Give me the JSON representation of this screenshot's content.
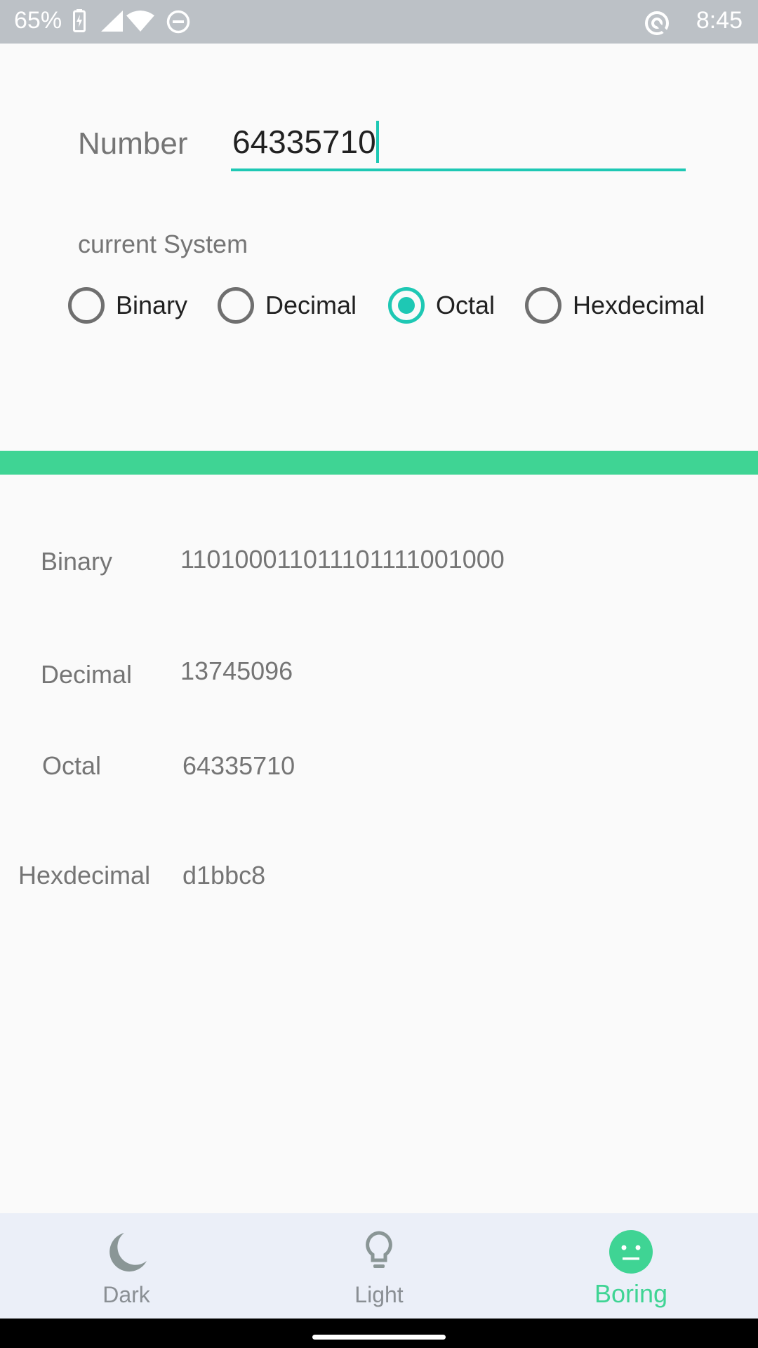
{
  "status_bar": {
    "battery": "65%",
    "time": "8:45"
  },
  "input": {
    "number_label": "Number",
    "number_value": "64335710",
    "system_label": "current System",
    "options": [
      "Binary",
      "Decimal",
      "Octal",
      "Hexdecimal"
    ],
    "selected": "Octal"
  },
  "results": [
    {
      "label": "Binary",
      "value": "110100011011101111001000"
    },
    {
      "label": "Decimal",
      "value": "13745096"
    },
    {
      "label": "Octal",
      "value": "64335710"
    },
    {
      "label": "Hexdecimal",
      "value": "d1bbc8"
    }
  ],
  "bottom_nav": {
    "items": [
      {
        "label": "Dark",
        "icon": "moon-icon",
        "active": false
      },
      {
        "label": "Light",
        "icon": "lightbulb-icon",
        "active": false
      },
      {
        "label": "Boring",
        "icon": "neutral-face-icon",
        "active": true
      }
    ]
  },
  "colors": {
    "accent": "#1ec8b4",
    "divider_green": "#3fd494",
    "status_bar": "#bcc1c6",
    "nav_background": "#ebeff8"
  }
}
